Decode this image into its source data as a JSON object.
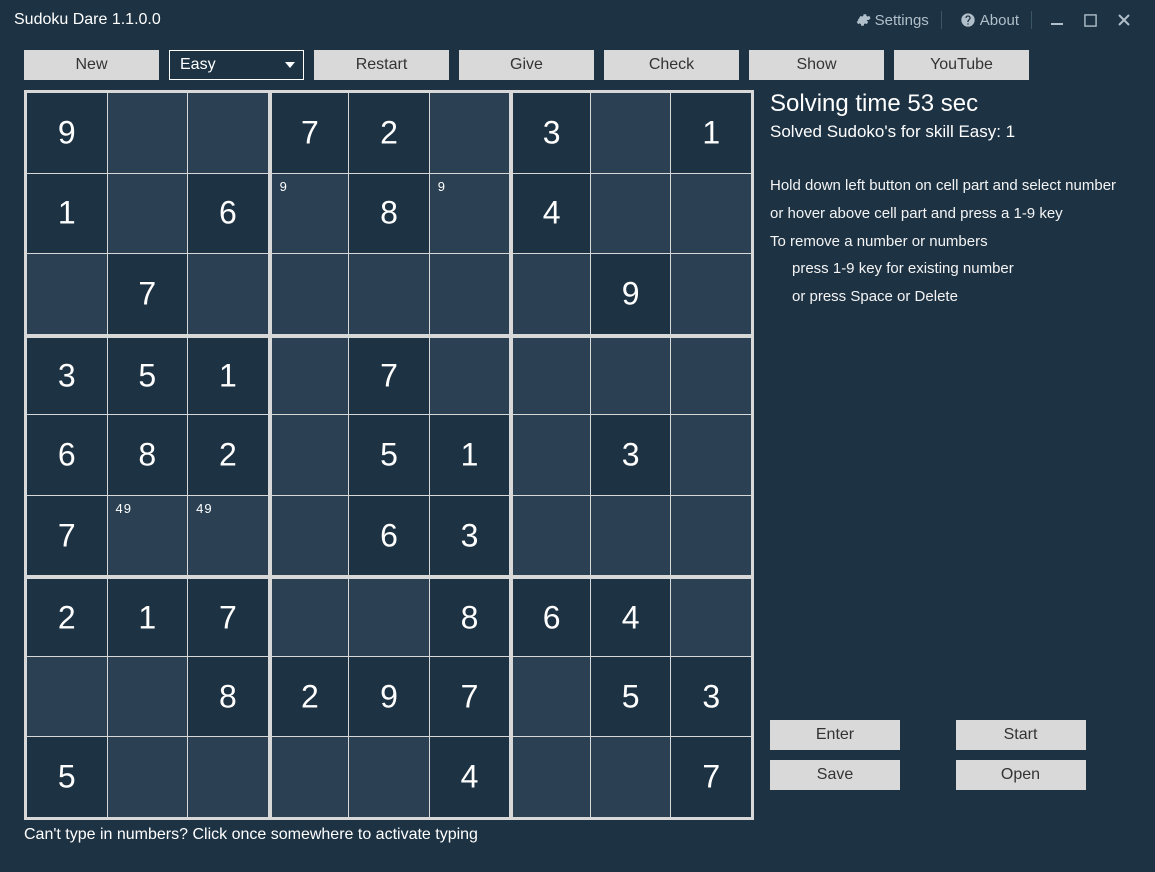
{
  "app": {
    "title": "Sudoku Dare 1.1.0.0",
    "settings_label": "Settings",
    "about_label": "About"
  },
  "toolbar": {
    "new_label": "New",
    "difficulty_selected": "Easy",
    "restart_label": "Restart",
    "give_label": "Give",
    "check_label": "Check",
    "show_label": "Show",
    "youtube_label": "YouTube"
  },
  "board": {
    "rows": [
      [
        {
          "v": "9",
          "g": true
        },
        {
          "v": ""
        },
        {
          "v": ""
        },
        {
          "v": "7",
          "g": true
        },
        {
          "v": "2",
          "g": true
        },
        {
          "v": ""
        },
        {
          "v": "3",
          "g": true
        },
        {
          "v": ""
        },
        {
          "v": "1",
          "g": true
        }
      ],
      [
        {
          "v": "1",
          "g": true
        },
        {
          "v": ""
        },
        {
          "v": "6",
          "g": true
        },
        {
          "v": "",
          "n": "9"
        },
        {
          "v": "8",
          "g": true
        },
        {
          "v": "",
          "n": "9"
        },
        {
          "v": "4",
          "g": true
        },
        {
          "v": ""
        },
        {
          "v": ""
        }
      ],
      [
        {
          "v": ""
        },
        {
          "v": "7",
          "g": true
        },
        {
          "v": ""
        },
        {
          "v": ""
        },
        {
          "v": ""
        },
        {
          "v": ""
        },
        {
          "v": ""
        },
        {
          "v": "9",
          "g": true
        },
        {
          "v": ""
        }
      ],
      [
        {
          "v": "3",
          "g": true
        },
        {
          "v": "5",
          "g": true
        },
        {
          "v": "1",
          "g": true
        },
        {
          "v": ""
        },
        {
          "v": "7",
          "g": true
        },
        {
          "v": ""
        },
        {
          "v": ""
        },
        {
          "v": ""
        },
        {
          "v": ""
        }
      ],
      [
        {
          "v": "6",
          "g": true
        },
        {
          "v": "8",
          "g": true
        },
        {
          "v": "2",
          "g": true
        },
        {
          "v": ""
        },
        {
          "v": "5",
          "g": true
        },
        {
          "v": "1",
          "g": true
        },
        {
          "v": ""
        },
        {
          "v": "3",
          "g": true
        },
        {
          "v": ""
        }
      ],
      [
        {
          "v": "7",
          "g": true
        },
        {
          "v": "",
          "n": "49"
        },
        {
          "v": "",
          "n": "49"
        },
        {
          "v": ""
        },
        {
          "v": "6",
          "g": true
        },
        {
          "v": "3",
          "g": true
        },
        {
          "v": ""
        },
        {
          "v": ""
        },
        {
          "v": ""
        }
      ],
      [
        {
          "v": "2",
          "g": true
        },
        {
          "v": "1",
          "g": true
        },
        {
          "v": "7",
          "g": true
        },
        {
          "v": ""
        },
        {
          "v": ""
        },
        {
          "v": "8",
          "g": true
        },
        {
          "v": "6",
          "g": true
        },
        {
          "v": "4",
          "g": true
        },
        {
          "v": ""
        }
      ],
      [
        {
          "v": ""
        },
        {
          "v": ""
        },
        {
          "v": "8",
          "g": true
        },
        {
          "v": "2",
          "g": true
        },
        {
          "v": "9",
          "g": true
        },
        {
          "v": "7",
          "g": true
        },
        {
          "v": ""
        },
        {
          "v": "5",
          "g": true
        },
        {
          "v": "3",
          "g": true
        }
      ],
      [
        {
          "v": "5",
          "g": true
        },
        {
          "v": ""
        },
        {
          "v": ""
        },
        {
          "v": ""
        },
        {
          "v": ""
        },
        {
          "v": "4",
          "g": true
        },
        {
          "v": ""
        },
        {
          "v": ""
        },
        {
          "v": "7",
          "g": true
        }
      ]
    ]
  },
  "side": {
    "solving_time": "Solving time 53 sec",
    "solved_count": "Solved Sudoko's for skill Easy: 1",
    "instr1": "Hold down left button on cell part and select number",
    "instr2": "or hover above cell part and press a 1-9 key",
    "instr3": "To remove a number or numbers",
    "instr4": "press 1-9 key for existing number",
    "instr5": "or press Space or Delete",
    "enter_label": "Enter",
    "start_label": "Start",
    "save_label": "Save",
    "open_label": "Open"
  },
  "footer": {
    "hint": "Can't type in numbers? Click once somewhere to activate typing"
  }
}
